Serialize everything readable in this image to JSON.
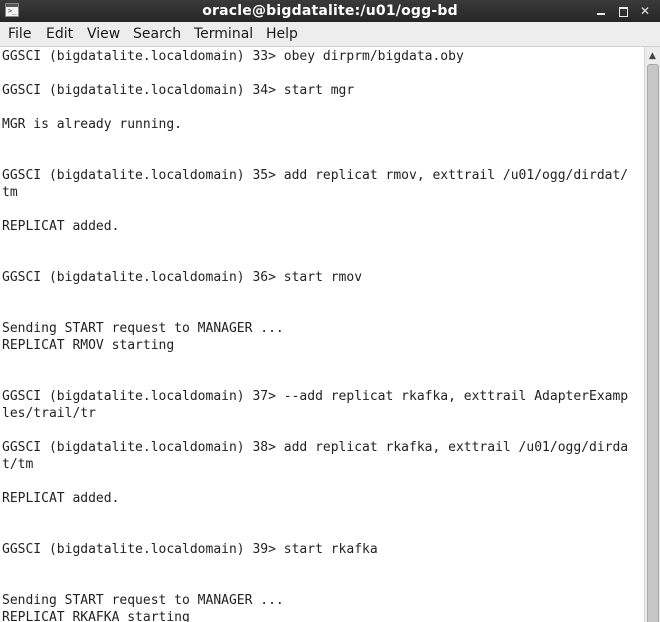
{
  "window": {
    "title": "oracle@bigdatalite:/u01/ogg-bd",
    "controls": {
      "minimize": "minimize-icon",
      "maximize": "maximize-icon",
      "close": "close-icon",
      "close_glyph": "✕"
    }
  },
  "menu": {
    "items": [
      "File",
      "Edit",
      "View",
      "Search",
      "Terminal",
      "Help"
    ]
  },
  "terminal": {
    "lines": [
      "GGSCI (bigdatalite.localdomain) 33> obey dirprm/bigdata.oby",
      "",
      "GGSCI (bigdatalite.localdomain) 34> start mgr",
      "",
      "MGR is already running.",
      "",
      "",
      "GGSCI (bigdatalite.localdomain) 35> add replicat rmov, exttrail /u01/ogg/dirdat/",
      "tm",
      "",
      "REPLICAT added.",
      "",
      "",
      "GGSCI (bigdatalite.localdomain) 36> start rmov",
      "",
      "",
      "Sending START request to MANAGER ...",
      "REPLICAT RMOV starting",
      "",
      "",
      "GGSCI (bigdatalite.localdomain) 37> --add replicat rkafka, exttrail AdapterExamp",
      "les/trail/tr",
      "",
      "GGSCI (bigdatalite.localdomain) 38> add replicat rkafka, exttrail /u01/ogg/dirda",
      "t/tm",
      "",
      "REPLICAT added.",
      "",
      "",
      "GGSCI (bigdatalite.localdomain) 39> start rkafka",
      "",
      "",
      "Sending START request to MANAGER ...",
      "REPLICAT RKAFKA starting"
    ]
  },
  "scrollbar": {
    "up_arrow": "▲"
  },
  "colors": {
    "titlebar": "#2f2f2f",
    "menubar": "#ededed",
    "terminal_bg": "#ffffff",
    "terminal_fg": "#222222"
  }
}
